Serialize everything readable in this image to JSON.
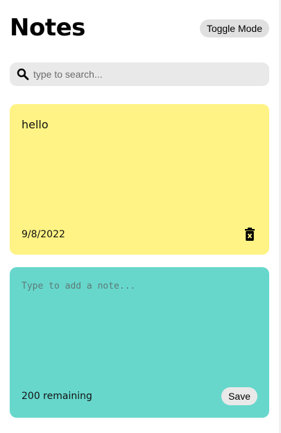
{
  "header": {
    "title": "Notes",
    "toggle_label": "Toggle Mode"
  },
  "search": {
    "placeholder": "type to search...",
    "value": "",
    "icon": "search-icon"
  },
  "notes": [
    {
      "text": "hello",
      "date": "9/8/2022",
      "color": "#fef384",
      "delete_icon": "trash-icon"
    }
  ],
  "new_note": {
    "placeholder": "Type to add a note...",
    "value": "",
    "remaining_label": "200 remaining",
    "save_label": "Save",
    "color": "#67d7cc"
  }
}
